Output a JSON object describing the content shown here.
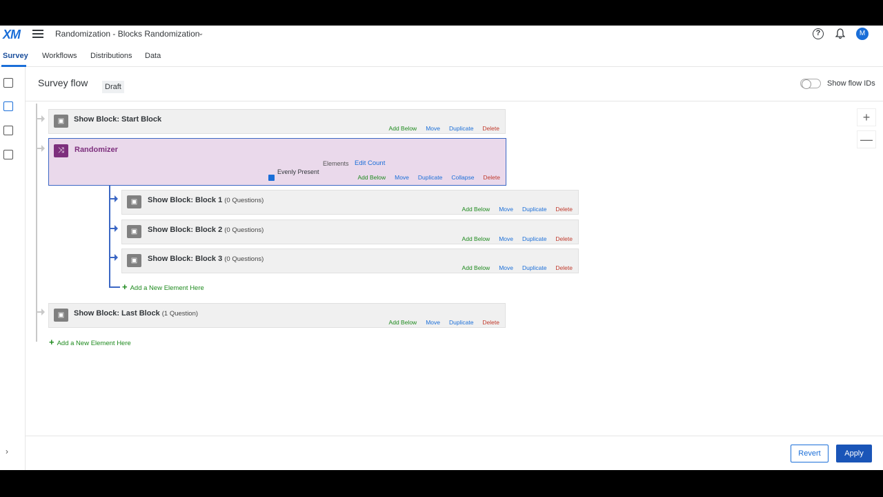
{
  "app": {
    "logo": "XM",
    "title": "Randomization - Blocks Randomization",
    "avatar_initial": "M"
  },
  "tabs": [
    {
      "label": "Survey",
      "active": true
    },
    {
      "label": "Workflows"
    },
    {
      "label": "Distributions"
    },
    {
      "label": "Data"
    }
  ],
  "header": {
    "title": "Survey flow",
    "badge": "Draft",
    "toggle_label": "Show flow IDs"
  },
  "zoom": {
    "in": "+",
    "out": "—"
  },
  "actions": {
    "add_below": "Add Below",
    "move": "Move",
    "duplicate": "Duplicate",
    "collapse": "Collapse",
    "delete": "Delete",
    "edit_count": "Edit Count",
    "add_new": "Add a New Element Here"
  },
  "blocks": {
    "start": {
      "name": "Show Block: Start Block",
      "count": ""
    },
    "b1": {
      "name": "Show Block: Block 1",
      "count": "(0 Questions)"
    },
    "b2": {
      "name": "Show Block: Block 2",
      "count": "(0 Questions)"
    },
    "b3": {
      "name": "Show Block: Block 3",
      "count": "(0 Questions)"
    },
    "last": {
      "name": "Show Block: Last Block",
      "count": "(1 Question)"
    }
  },
  "randomizer": {
    "name": "Randomizer",
    "description": "Evenly Present",
    "elements_label": "Elements"
  },
  "footer": {
    "revert": "Revert",
    "apply": "Apply"
  },
  "colors": {
    "accent": "#1a6ed8",
    "randomizer_bg": "#ead9eb",
    "add": "#1e8a1e",
    "delete": "#c0392b"
  }
}
